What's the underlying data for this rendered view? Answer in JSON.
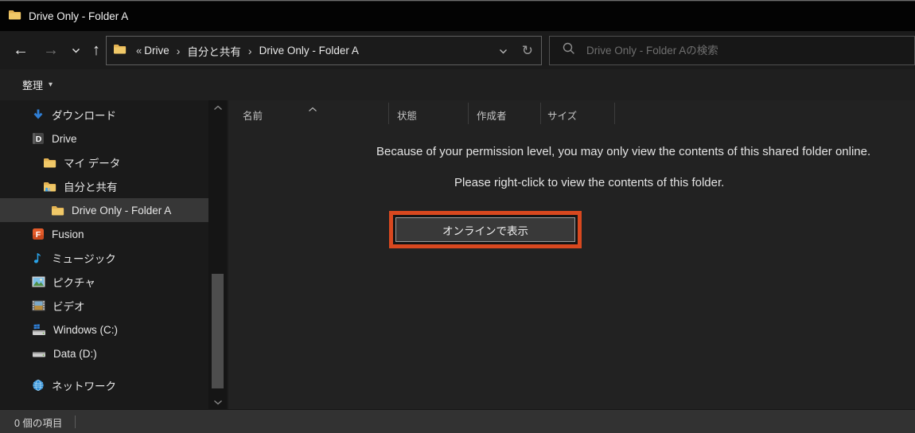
{
  "window": {
    "title": "Drive Only - Folder A"
  },
  "navbar": {
    "back_icon": "left-arrow-icon",
    "forward_icon": "right-arrow-icon",
    "up_icon": "up-arrow-icon",
    "breadcrumb": {
      "collapse": "«",
      "separator": "›",
      "items": [
        {
          "label": "Drive"
        },
        {
          "label": "自分と共有"
        },
        {
          "label": "Drive Only - Folder A"
        }
      ]
    },
    "search_placeholder": "Drive Only - Folder Aの検索"
  },
  "toolbar": {
    "organize_label": "整理",
    "organize_caret": "▾"
  },
  "sidebar": {
    "items": [
      {
        "label": "ダウンロード",
        "icon": "downloads-icon",
        "level": 1,
        "selected": false
      },
      {
        "label": "Drive",
        "icon": "drive-app-icon",
        "level": 1,
        "selected": false
      },
      {
        "label": "マイ データ",
        "icon": "folder-icon",
        "level": 2,
        "selected": false
      },
      {
        "label": "自分と共有",
        "icon": "shared-folder-icon",
        "level": 2,
        "selected": false
      },
      {
        "label": "Drive Only - Folder A",
        "icon": "folder-icon",
        "level": 3,
        "selected": true
      },
      {
        "label": "Fusion",
        "icon": "fusion-icon",
        "level": 1,
        "selected": false
      },
      {
        "label": "ミュージック",
        "icon": "music-icon",
        "level": 1,
        "selected": false
      },
      {
        "label": "ピクチャ",
        "icon": "pictures-icon",
        "level": 1,
        "selected": false
      },
      {
        "label": "ビデオ",
        "icon": "videos-icon",
        "level": 1,
        "selected": false
      },
      {
        "label": "Windows (C:)",
        "icon": "windows-drive-icon",
        "level": 1,
        "selected": false
      },
      {
        "label": "Data (D:)",
        "icon": "data-drive-icon",
        "level": 1,
        "selected": false
      },
      {
        "label": "ネットワーク",
        "icon": "network-icon",
        "level": 1,
        "selected": false
      }
    ]
  },
  "main": {
    "columns": [
      "名前",
      "状態",
      "作成者",
      "サイズ"
    ],
    "message_line1": "Because of your permission level, you may only view the contents of this shared folder online.",
    "message_line2": "Please right-click to view the contents of this folder.",
    "view_online_button": "オンラインで表示"
  },
  "statusbar": {
    "item_count": "0 個の項目"
  },
  "glyphs": {
    "refresh": "↻",
    "back": "←",
    "forward": "→",
    "up": "↑"
  },
  "colors": {
    "highlight_orange": "#d8481f",
    "folder_yellow": "#f0c868",
    "accent_blue": "#2f7fd6",
    "selected_row": "#373737"
  }
}
